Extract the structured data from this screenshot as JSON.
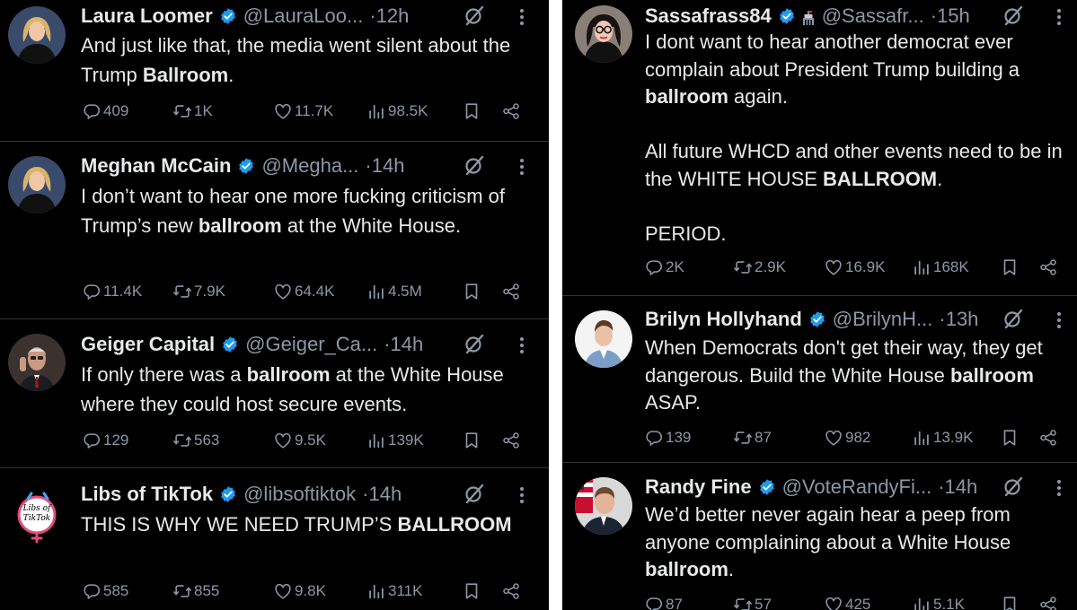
{
  "feed": {
    "left": [
      {
        "name": "Laura Loomer",
        "handle": "@LauraLoo...",
        "time": "12h",
        "text_parts": [
          {
            "t": "And just like that, the media went silent about the Trump "
          },
          {
            "t": "Ballroom",
            "b": true
          },
          {
            "t": "."
          }
        ],
        "replies": "409",
        "reposts": "1K",
        "likes": "11.7K",
        "views": "98.5K",
        "avatar_icon": "person-blonde-avatar"
      },
      {
        "name": "Meghan McCain",
        "handle": "@Megha...",
        "time": "14h",
        "text_parts": [
          {
            "t": "I don’t want to hear one more fucking criticism of Trump’s new "
          },
          {
            "t": "ballroom",
            "b": true
          },
          {
            "t": " at the White House."
          }
        ],
        "replies": "11.4K",
        "reposts": "7.9K",
        "likes": "64.4K",
        "views": "4.5M",
        "avatar_icon": "person-blonde-avatar"
      },
      {
        "name": "Geiger Capital",
        "handle": "@Geiger_Ca...",
        "time": "14h",
        "text_parts": [
          {
            "t": "If only there was a "
          },
          {
            "t": "ballroom",
            "b": true
          },
          {
            "t": " at the White House where they could host secure events."
          }
        ],
        "replies": "129",
        "reposts": "563",
        "likes": "9.5K",
        "views": "139K",
        "avatar_icon": "person-on-phone-avatar"
      },
      {
        "name": "Libs of TikTok",
        "handle": "@libsoftiktok",
        "time": "14h",
        "text_parts": [
          {
            "t": "THIS IS WHY WE NEED TRUMP’S "
          },
          {
            "t": "BALLROOM",
            "b": true
          }
        ],
        "replies": "585",
        "reposts": "855",
        "likes": "9.8K",
        "views": "311K",
        "avatar_icon": "libs-of-tiktok-logo",
        "logo_text": "Libs of TikTok"
      }
    ],
    "right": [
      {
        "name": "Sassafrass84",
        "handle": "@Sassafr...",
        "time": "15h",
        "flag_icon": "government-flag-icon",
        "text_paragraphs": [
          [
            {
              "t": "I dont want to hear another democrat ever complain about President Trump building a "
            },
            {
              "t": "ballroom",
              "b": true
            },
            {
              "t": " again."
            }
          ],
          [
            {
              "t": "All future WHCD and other events need to be in the WHITE HOUSE "
            },
            {
              "t": "BALLROOM",
              "b": true
            },
            {
              "t": "."
            }
          ],
          [
            {
              "t": "PERIOD."
            }
          ]
        ],
        "replies": "2K",
        "reposts": "2.9K",
        "likes": "16.9K",
        "views": "168K",
        "avatar_icon": "woman-glasses-avatar"
      },
      {
        "name": "Brilyn Hollyhand",
        "handle": "@BrilynH...",
        "time": "13h",
        "text_parts": [
          {
            "t": "When Democrats don't get their way, they get dangerous. Build the White House "
          },
          {
            "t": "ballroom",
            "b": true
          },
          {
            "t": " ASAP."
          }
        ],
        "replies": "139",
        "reposts": "87",
        "likes": "982",
        "views": "13.9K",
        "avatar_icon": "young-man-suit-avatar"
      },
      {
        "name": "Randy Fine",
        "handle": "@VoteRandyFi...",
        "time": "14h",
        "text_parts": [
          {
            "t": "We’d better never again hear a peep from anyone complaining about a White House "
          },
          {
            "t": "ballroom",
            "b": true
          },
          {
            "t": "."
          }
        ],
        "replies": "87",
        "reposts": "57",
        "likes": "425",
        "views": "5.1K",
        "avatar_icon": "man-flag-avatar"
      }
    ]
  },
  "colors": {
    "background": "#000000",
    "text": "#e7e9ea",
    "muted": "#8b98a5",
    "verified": "#1d9bf0",
    "divider": "#2f3336"
  },
  "icons": {
    "verified": "verified-badge-icon",
    "grok": "grok-icon",
    "more": "more-options-icon",
    "reply": "reply-icon",
    "repost": "repost-icon",
    "like": "like-icon",
    "views": "views-icon",
    "bookmark": "bookmark-icon",
    "share": "share-icon"
  }
}
